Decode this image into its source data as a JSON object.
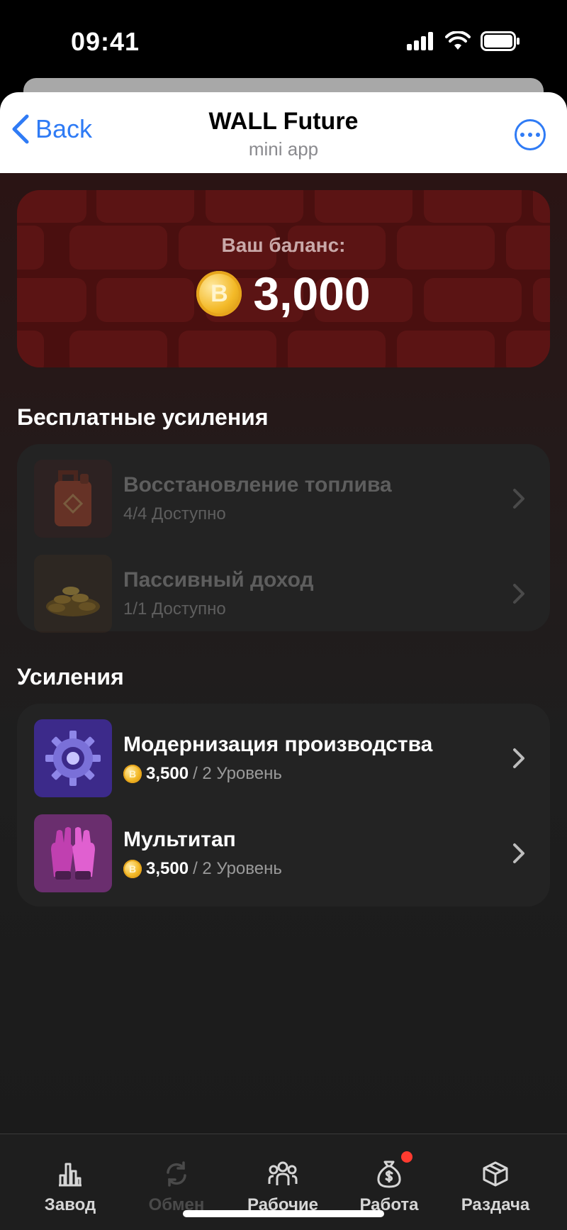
{
  "status_bar": {
    "time": "09:41"
  },
  "header": {
    "back_label": "Back",
    "title": "WALL Future",
    "subtitle": "mini app"
  },
  "balance": {
    "label": "Ваш баланс:",
    "value": "3,000",
    "coin_symbol": "B"
  },
  "free_boosts": {
    "title": "Бесплатные усиления",
    "items": [
      {
        "title": "Восстановление топлива",
        "subtitle": "4/4 Доступно",
        "icon": "fuel-canister-icon"
      },
      {
        "title": "Пассивный доход",
        "subtitle": "1/1 Доступно",
        "icon": "coin-pile-icon"
      }
    ]
  },
  "boosts": {
    "title": "Усиления",
    "items": [
      {
        "title": "Модернизация производства",
        "price": "3,500",
        "level": "/ 2 Уровень",
        "icon": "gear-icon"
      },
      {
        "title": "Мультитап",
        "price": "3,500",
        "level": "/ 2 Уровень",
        "icon": "gloves-icon"
      }
    ]
  },
  "nav": {
    "items": [
      {
        "label": "Завод",
        "icon": "factory-icon"
      },
      {
        "label": "Обмен",
        "icon": "exchange-icon"
      },
      {
        "label": "Рабочие",
        "icon": "workers-icon"
      },
      {
        "label": "Работа",
        "icon": "money-bag-icon"
      },
      {
        "label": "Раздача",
        "icon": "box-icon"
      }
    ]
  },
  "colors": {
    "accent": "#2f7bf5",
    "coin": "#f3b927",
    "background": "#1b1b1b",
    "card": "#232323",
    "badge": "#ff3b30"
  }
}
